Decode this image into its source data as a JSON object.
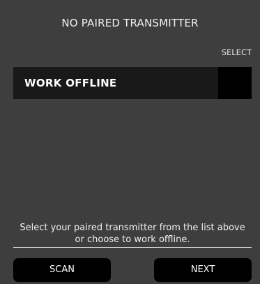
{
  "header": {
    "title": "NO PAIRED TRANSMITTER"
  },
  "list": {
    "column_header": "SELECT",
    "rows": [
      {
        "label": "WORK OFFLINE",
        "selected": false
      }
    ]
  },
  "footer": {
    "hint": "Select your paired transmitter from the list above or choose to work offline.",
    "scan_label": "SCAN",
    "next_label": "NEXT"
  },
  "colors": {
    "background": "#3e3e3e",
    "row_background": "#191919",
    "button_background": "#000000",
    "text": "#ffffff"
  }
}
